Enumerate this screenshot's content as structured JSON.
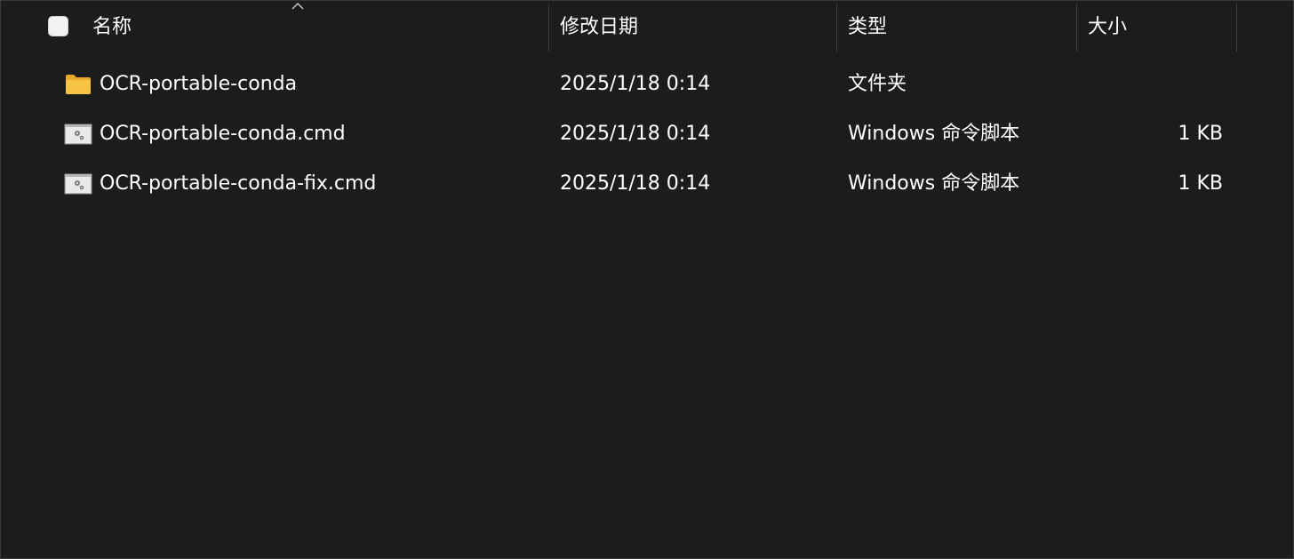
{
  "header": {
    "select_all_checked": false,
    "columns": {
      "name": "名称",
      "modified": "修改日期",
      "type": "类型",
      "size": "大小"
    },
    "sort": {
      "column": "name",
      "direction": "ascending"
    }
  },
  "files": [
    {
      "name": "OCR-portable-conda",
      "modified": "2025/1/18 0:14",
      "type": "文件夹",
      "size": "",
      "icon": "folder-icon"
    },
    {
      "name": "OCR-portable-conda.cmd",
      "modified": "2025/1/18 0:14",
      "type": "Windows 命令脚本",
      "size": "1 KB",
      "icon": "cmd-script-icon"
    },
    {
      "name": "OCR-portable-conda-fix.cmd",
      "modified": "2025/1/18 0:14",
      "type": "Windows 命令脚本",
      "size": "1 KB",
      "icon": "cmd-script-icon"
    }
  ],
  "colors": {
    "background": "#1c1c1c",
    "text": "#ffffff",
    "folder": "#f6c344"
  }
}
